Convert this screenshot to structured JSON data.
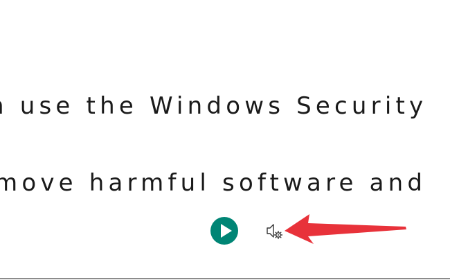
{
  "reader": {
    "text_lines": [
      "n use the Windows Security",
      "move harmful software and"
    ]
  },
  "controls": {
    "play_icon": "play-icon",
    "voice_settings_icon": "speaker-settings-icon"
  },
  "colors": {
    "accent": "#008575",
    "annotation": "#e8323a",
    "text": "#1a1a1a"
  }
}
